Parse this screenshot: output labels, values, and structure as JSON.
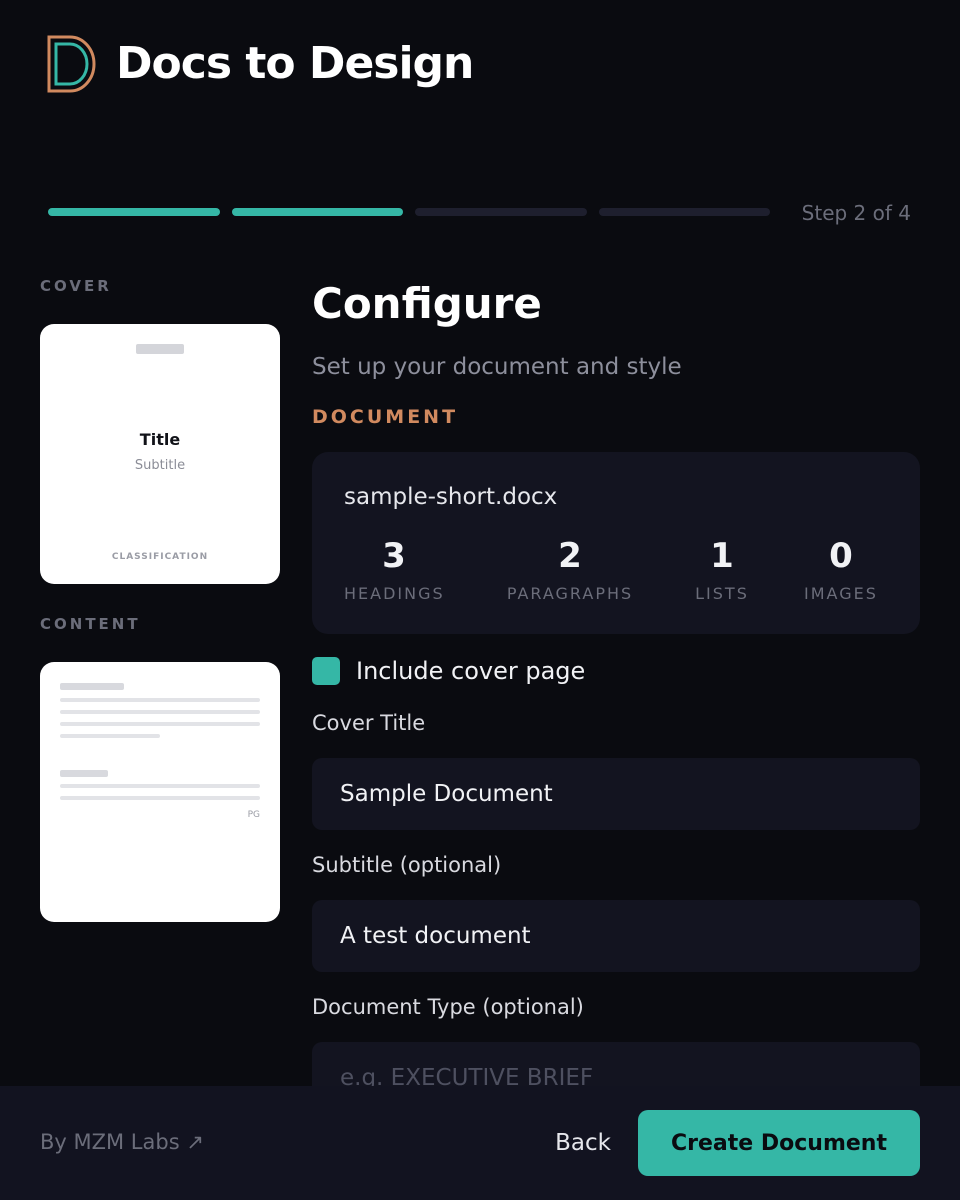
{
  "app": {
    "title": "Docs to Design"
  },
  "colors": {
    "accent": "#35b7a6",
    "orange": "#d18a5f",
    "background": "#0a0b10",
    "card": "#131420"
  },
  "progress": {
    "step_label": "Step 2 of 4",
    "current": 2,
    "total": 4
  },
  "previews": {
    "cover_label": "COVER",
    "cover": {
      "title": "Title",
      "subtitle": "Subtitle",
      "classification": "CLASSIFICATION"
    },
    "content_label": "CONTENT",
    "content": {
      "page_label": "PG"
    }
  },
  "main": {
    "title": "Configure",
    "subtitle": "Set up your document and style",
    "section_label": "DOCUMENT",
    "document": {
      "filename": "sample-short.docx",
      "stats": [
        {
          "value": "3",
          "label": "HEADINGS"
        },
        {
          "value": "2",
          "label": "PARAGRAPHS"
        },
        {
          "value": "1",
          "label": "LISTS"
        },
        {
          "value": "0",
          "label": "IMAGES"
        }
      ]
    },
    "include_cover": {
      "label": "Include cover page",
      "checked": true
    },
    "fields": {
      "cover_title": {
        "label": "Cover Title",
        "value": "Sample Document"
      },
      "subtitle": {
        "label": "Subtitle (optional)",
        "value": "A test document"
      },
      "doc_type": {
        "label": "Document Type (optional)",
        "placeholder": "e.g. EXECUTIVE BRIEF"
      }
    }
  },
  "footer": {
    "byline": "By MZM Labs ↗",
    "back_label": "Back",
    "create_label": "Create Document"
  }
}
